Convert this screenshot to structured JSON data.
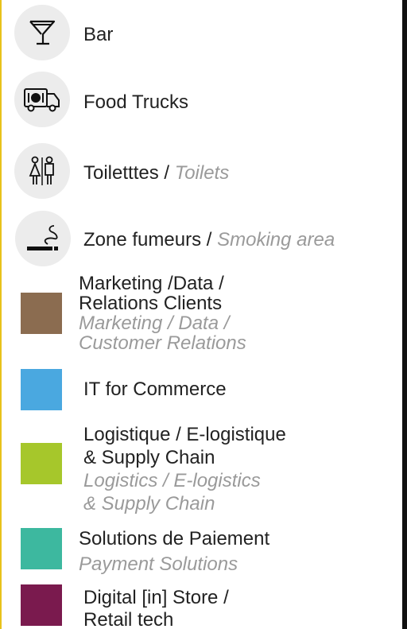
{
  "legend": {
    "items": [
      {
        "id": "bar",
        "icon": "cocktail-glass-icon",
        "label": "Bar"
      },
      {
        "id": "food-trucks",
        "icon": "food-truck-icon",
        "label": "Food Trucks"
      },
      {
        "id": "toilets",
        "icon": "toilets-icon",
        "label_fr": "Toiletttes",
        "sep": "/",
        "label_en": "Toilets"
      },
      {
        "id": "smoking",
        "icon": "smoking-icon",
        "label_fr": "Zone fumeurs",
        "sep": "/",
        "label_en": "Smoking area"
      },
      {
        "id": "marketing",
        "color": "#8b6c50",
        "fr_line1": "Marketing /Data /",
        "fr_line2": "Relations Clients",
        "en_line1": "Marketing / Data /",
        "en_line2": "Customer Relations"
      },
      {
        "id": "it-commerce",
        "color": "#4aa8e0",
        "label": "IT for Commerce"
      },
      {
        "id": "logistics",
        "color": "#a6c72b",
        "fr_line1": "Logistique / E-logistique",
        "fr_line2": "& Supply Chain",
        "en_line1": "Logistics / E-logistics",
        "en_line2": "& Supply Chain"
      },
      {
        "id": "payment",
        "color": "#3db89f",
        "fr_line1": "Solutions de Paiement",
        "en_line1": "Payment Solutions"
      },
      {
        "id": "digital-store",
        "color": "#7a1a4e",
        "fr_line1": "Digital [in] Store /",
        "fr_line2": "Retail tech"
      }
    ]
  },
  "colors": {
    "panel_border": "#e8c21a",
    "background_dark": "#111111",
    "icon_circle": "#ececec"
  }
}
